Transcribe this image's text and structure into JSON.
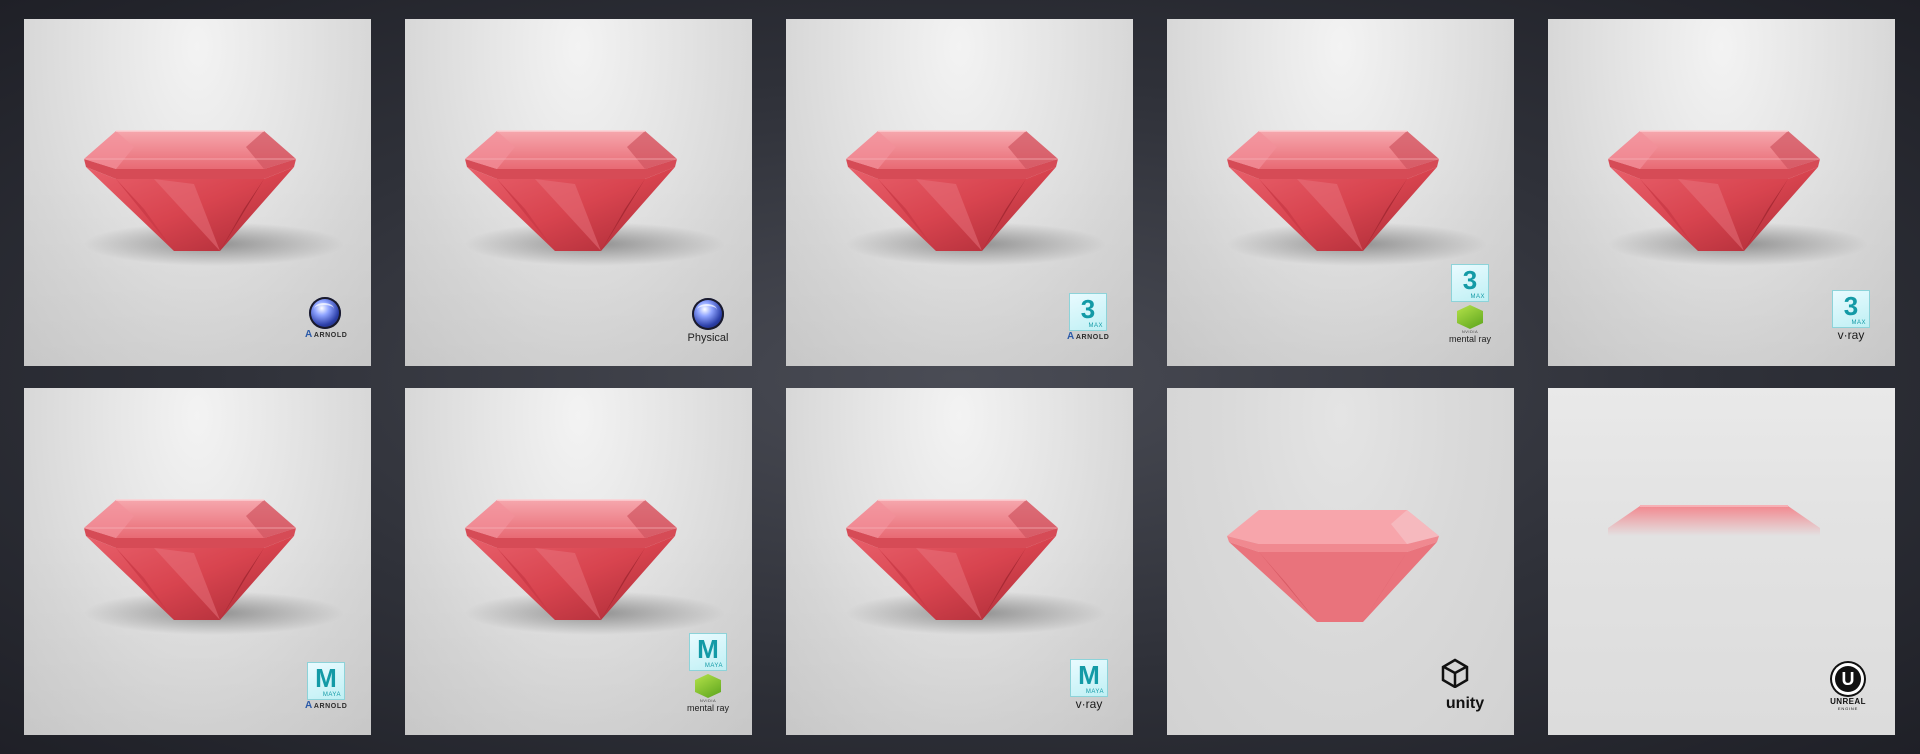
{
  "colors": {
    "background": "#2f3139",
    "gem": "#e0515c",
    "gem_dark": "#b8343f",
    "gem_light": "#f39aa2"
  },
  "tiles": [
    {
      "icons": [
        "cinema4d-icon"
      ],
      "label": "ARNOLD"
    },
    {
      "icons": [
        "cinema4d-icon"
      ],
      "label": "Physical"
    },
    {
      "icons": [
        "3dsmax-icon"
      ],
      "box": "3",
      "box_sub": "MAX",
      "label": "ARNOLD"
    },
    {
      "icons": [
        "3dsmax-icon",
        "mental-ray-icon"
      ],
      "box": "3",
      "box_sub": "MAX",
      "mr_sub": "NVIDIA",
      "label": "mental ray"
    },
    {
      "icons": [
        "3dsmax-icon"
      ],
      "box": "3",
      "box_sub": "MAX",
      "label": "v·ray"
    },
    {
      "icons": [
        "maya-icon"
      ],
      "box": "M",
      "box_sub": "MAYA",
      "label": "ARNOLD"
    },
    {
      "icons": [
        "maya-icon",
        "mental-ray-icon"
      ],
      "box": "M",
      "box_sub": "MAYA",
      "mr_sub": "NVIDIA",
      "label": "mental ray"
    },
    {
      "icons": [
        "maya-icon"
      ],
      "box": "M",
      "box_sub": "MAYA",
      "label": "v·ray"
    },
    {
      "icons": [
        "unity-icon"
      ],
      "label": "unity"
    },
    {
      "icons": [
        "unreal-engine-icon"
      ],
      "label": "UNREAL",
      "label_sub": "ENGINE"
    }
  ]
}
